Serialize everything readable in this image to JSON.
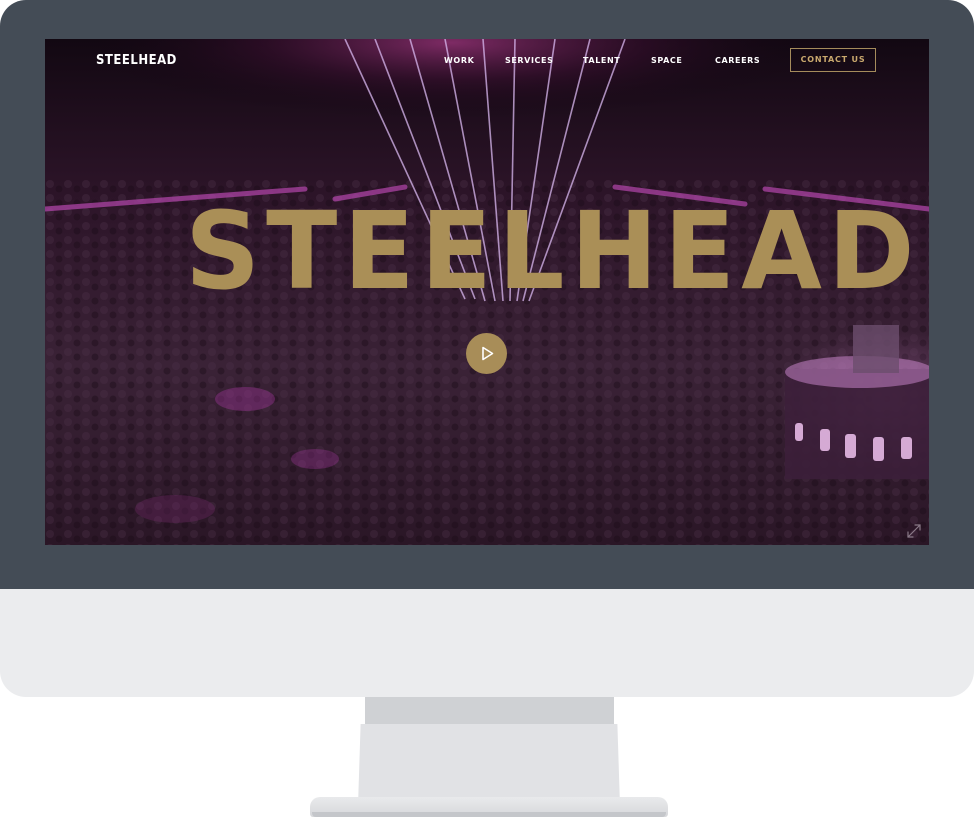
{
  "site": {
    "logo": "STEELHEAD",
    "hero_title": "STEELHEAD"
  },
  "nav": {
    "items": [
      {
        "label": "WORK"
      },
      {
        "label": "SERVICES"
      },
      {
        "label": "TALENT"
      },
      {
        "label": "SPACE"
      },
      {
        "label": "CAREERS"
      }
    ],
    "contact_label": "CONTACT US"
  },
  "icons": {
    "play": "play-icon",
    "expand": "expand-icon"
  },
  "colors": {
    "brand_gold": "#aa8f57",
    "contact_text": "#c9a96e",
    "bezel": "#444c56",
    "chin": "#ebecee",
    "hero_bg": "#1a0a19",
    "laser": "#d9b8f0",
    "stage_glow": "#e14bd8"
  }
}
